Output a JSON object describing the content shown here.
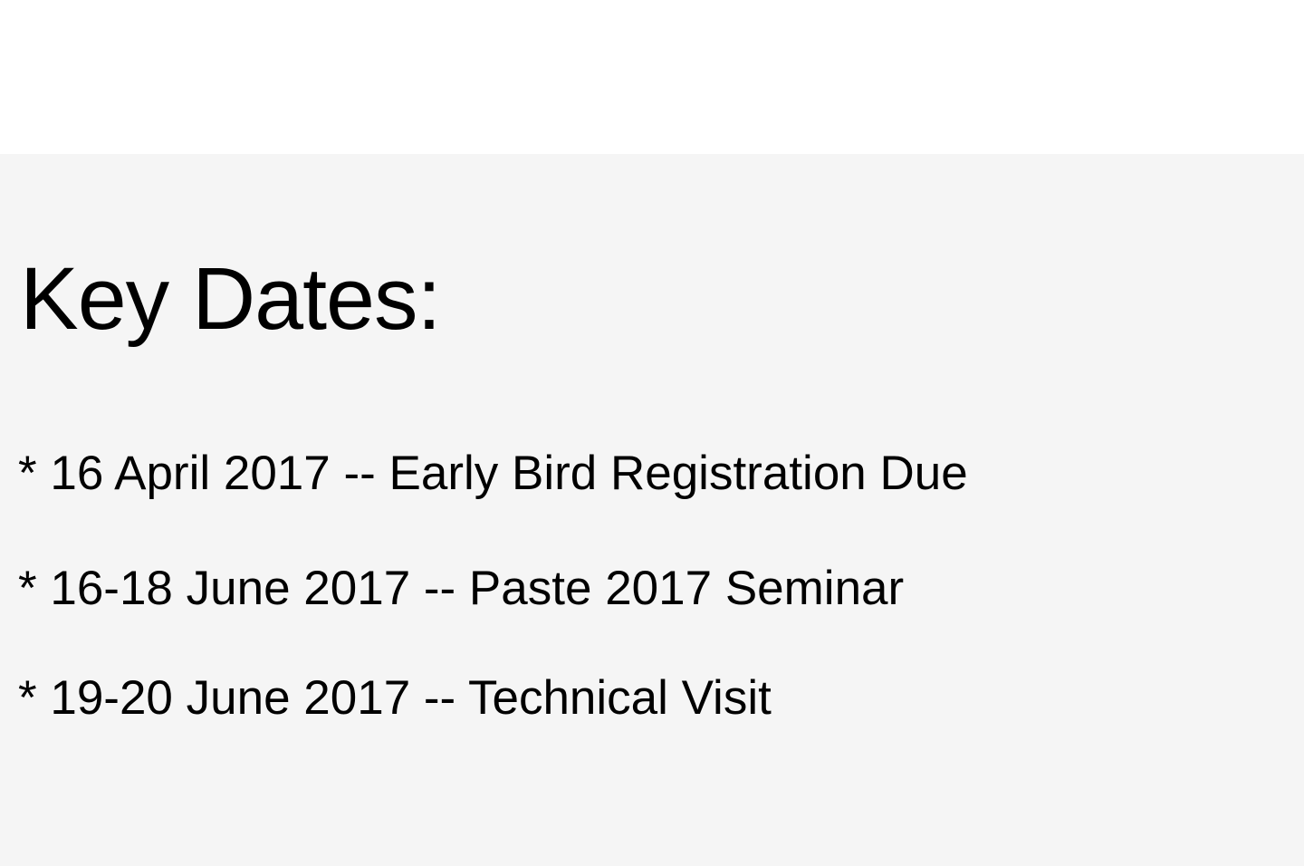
{
  "heading": "Key Dates:",
  "key_dates": [
    "* 16 April 2017 -- Early Bird Registration Due",
    "* 16-18 June 2017 -- Paste 2017 Seminar",
    "* 19-20 June 2017 -- Technical Visit"
  ],
  "colors": {
    "page_background": "#ffffff",
    "panel_background": "#f5f5f5",
    "text": "#000000"
  }
}
